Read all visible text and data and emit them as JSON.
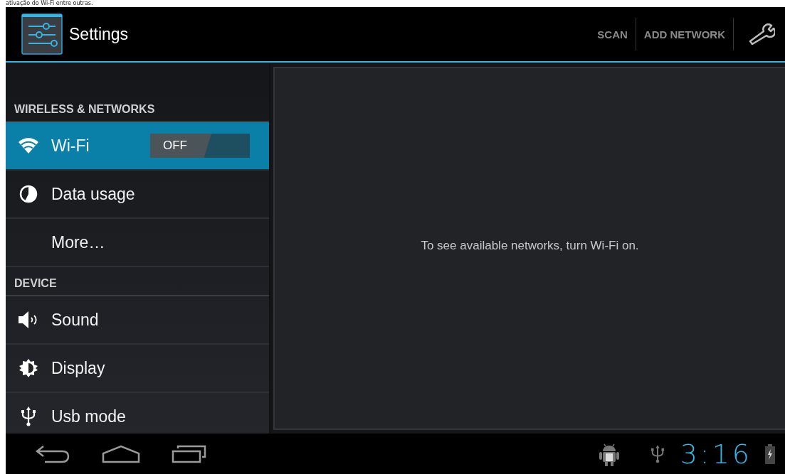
{
  "caption": "ativação do Wi-Fi entre outras.",
  "action_bar": {
    "title": "Settings",
    "actions": [
      "SCAN",
      "ADD NETWORK"
    ]
  },
  "sidebar": {
    "items": [
      {
        "kind": "header",
        "label": "WIRELESS & NETWORKS"
      },
      {
        "kind": "toggle",
        "label": "Wi-Fi",
        "selected": true,
        "toggle": {
          "label": "OFF",
          "on": false
        }
      },
      {
        "kind": "item",
        "label": "Data usage",
        "selected": false
      },
      {
        "kind": "item",
        "label": "More…",
        "selected": false
      },
      {
        "kind": "header",
        "label": "DEVICE"
      },
      {
        "kind": "item",
        "label": "Sound",
        "selected": false
      },
      {
        "kind": "item",
        "label": "Display",
        "selected": false
      },
      {
        "kind": "item",
        "label": "Usb mode",
        "selected": false
      }
    ]
  },
  "detail": {
    "message": "To see available networks, turn Wi-Fi on."
  },
  "system_bar": {
    "time": "3:16"
  }
}
